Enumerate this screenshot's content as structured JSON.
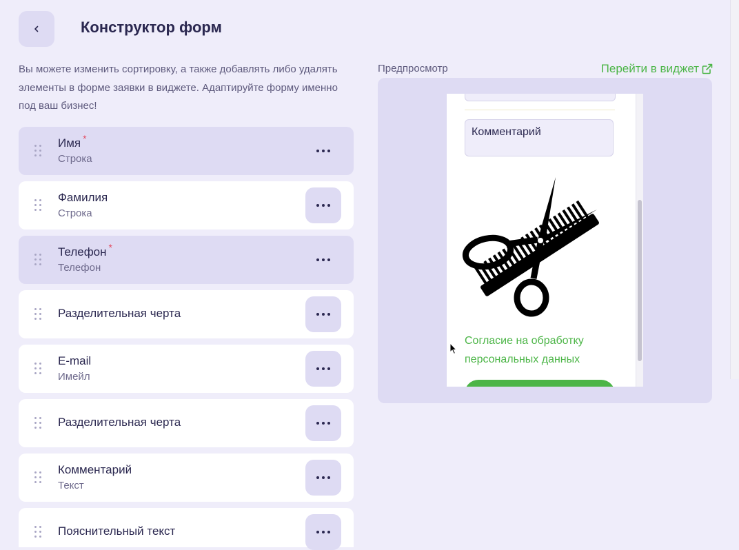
{
  "header": {
    "title": "Конструктор форм"
  },
  "description": "Вы можете изменить сортировку, а также добавлять либо удалять элементы в форме заявки в виджете. Адаптируйте форму именно под ваш бизнес!",
  "fields": [
    {
      "title": "Имя",
      "subtitle": "Строка",
      "required": true
    },
    {
      "title": "Фамилия",
      "subtitle": "Строка",
      "required": false
    },
    {
      "title": "Телефон",
      "subtitle": "Телефон",
      "required": true
    },
    {
      "title": "Разделительная черта",
      "subtitle": "",
      "required": false
    },
    {
      "title": "E-mail",
      "subtitle": "Имейл",
      "required": false
    },
    {
      "title": "Разделительная черта",
      "subtitle": "",
      "required": false
    },
    {
      "title": "Комментарий",
      "subtitle": "Текст",
      "required": false
    },
    {
      "title": "Пояснительный текст",
      "subtitle": "",
      "required": false
    }
  ],
  "required_mark": "*",
  "preview": {
    "label": "Предпросмотр",
    "widget_link": "Перейти в виджет",
    "comment_placeholder": "Комментарий",
    "consent": "Согласие на обработку персональных данных"
  },
  "colors": {
    "accent_green": "#4cb547",
    "required_row_bg": "#dedbf3",
    "required_star": "#e24a5f"
  },
  "icons": {
    "back": "chevron-left-icon",
    "drag": "drag-handle-icon",
    "more": "more-horizontal-icon",
    "external": "external-link-icon",
    "image": "scissors-comb-icon"
  }
}
